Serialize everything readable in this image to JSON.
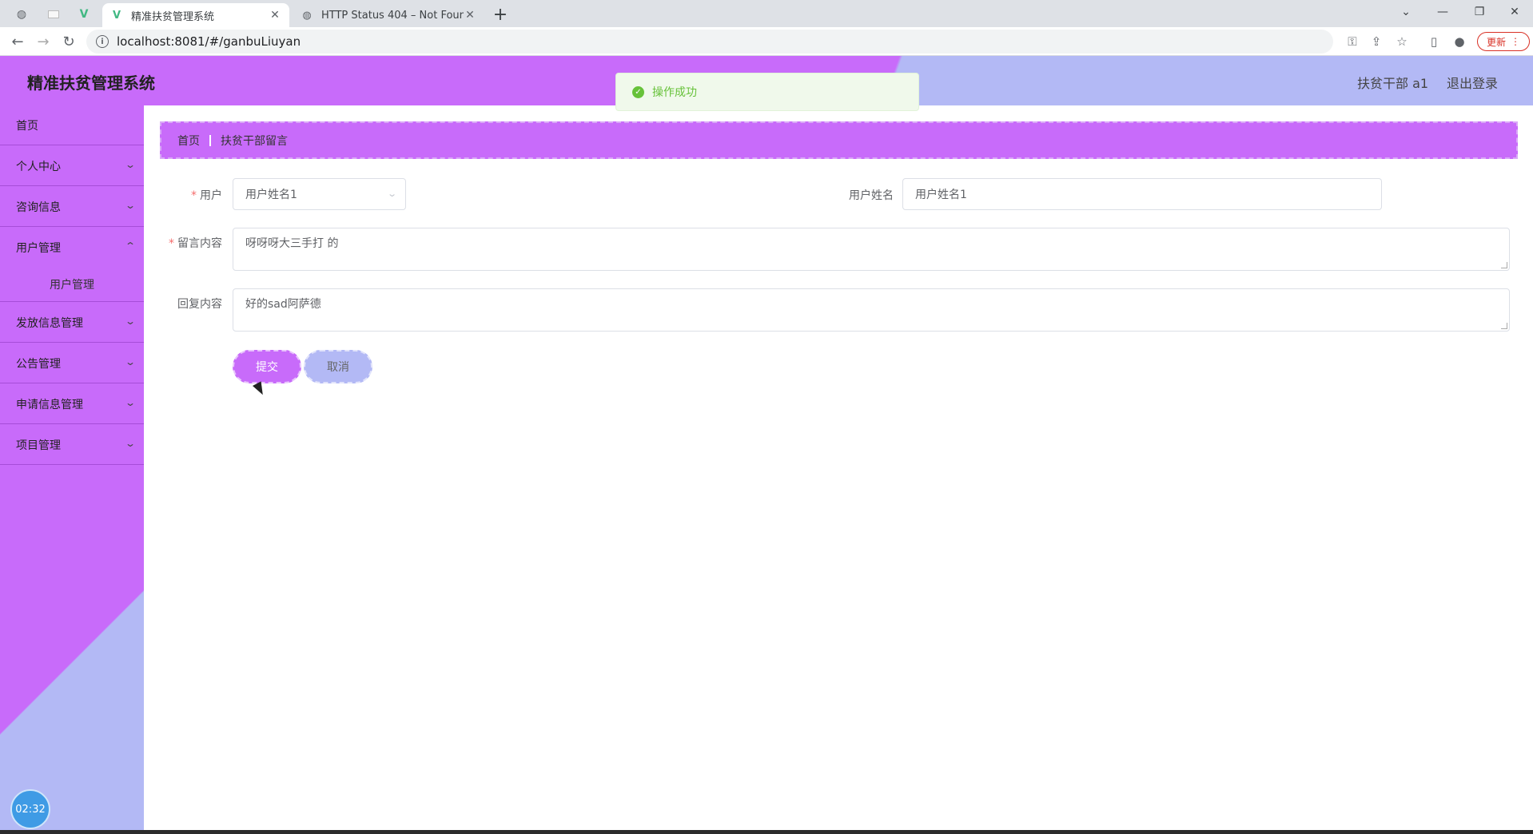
{
  "browser": {
    "tabs": [
      {
        "title": "",
        "icon": "globe-icon"
      },
      {
        "title": "",
        "icon": "blank-icon"
      },
      {
        "title": "",
        "icon": "vue-icon"
      },
      {
        "title": "精准扶贫管理系统",
        "icon": "vue-icon",
        "active": true
      },
      {
        "title": "HTTP Status 404 – Not Found",
        "icon": "globe-icon"
      }
    ],
    "url": "localhost:8081/#/ganbuLiuyan",
    "update_label": "更新"
  },
  "header": {
    "title": "精准扶贫管理系统",
    "user_label": "扶贫干部 a1",
    "logout_label": "退出登录"
  },
  "toast": {
    "message": "操作成功",
    "color": "#67c23a"
  },
  "sidebar": {
    "items": [
      {
        "label": "首页",
        "expandable": false
      },
      {
        "label": "个人中心",
        "expandable": true
      },
      {
        "label": "咨询信息",
        "expandable": true
      },
      {
        "label": "用户管理",
        "expandable": true,
        "expanded": true,
        "children": [
          "用户管理"
        ]
      },
      {
        "label": "发放信息管理",
        "expandable": true
      },
      {
        "label": "公告管理",
        "expandable": true
      },
      {
        "label": "申请信息管理",
        "expandable": true
      },
      {
        "label": "项目管理",
        "expandable": true
      }
    ],
    "clock": "02:32"
  },
  "breadcrumb": {
    "home": "首页",
    "current": "扶贫干部留言"
  },
  "form": {
    "user_label": "用户",
    "user_value": "用户姓名1",
    "username_label": "用户姓名",
    "username_value": "用户姓名1",
    "message_label": "留言内容",
    "message_value": "呀呀呀大三手打 的",
    "reply_label": "回复内容",
    "reply_value": "好的sad阿萨德",
    "submit_label": "提交",
    "cancel_label": "取消"
  },
  "colors": {
    "primary": "#c86bfa",
    "secondary": "#b3b9f5",
    "required": "#f56c6c"
  }
}
